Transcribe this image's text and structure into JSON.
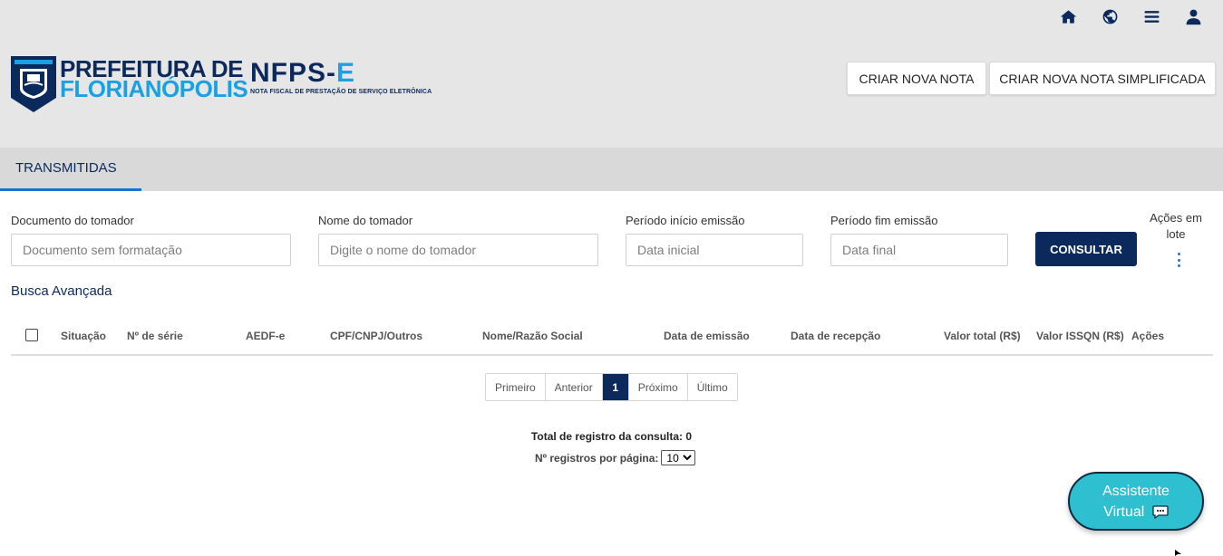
{
  "header": {
    "brand": {
      "line1": "PREFEITURA DE",
      "line2": "FLORIANÓPOLIS"
    },
    "product": {
      "title_main": "NFPS-",
      "title_accent": "E",
      "subtitle": "NOTA FISCAL DE PRESTAÇÃO DE SERVIÇO ELETRÔNICA"
    },
    "icons": [
      "home-icon",
      "globe-icon",
      "menu-icon",
      "user-icon"
    ],
    "buttons": {
      "new_note": "CRIAR NOVA NOTA",
      "new_simple_note": "CRIAR NOVA NOTA SIMPLIFICADA"
    }
  },
  "tabs": [
    {
      "label": "TRANSMITIDAS",
      "active": true
    }
  ],
  "filters": {
    "documento": {
      "label": "Documento do tomador",
      "placeholder": "Documento sem formatação",
      "value": ""
    },
    "nome": {
      "label": "Nome do tomador",
      "placeholder": "Digite o nome do tomador",
      "value": ""
    },
    "inicio": {
      "label": "Período início emissão",
      "placeholder": "Data inicial",
      "value": ""
    },
    "fim": {
      "label": "Período fim emissão",
      "placeholder": "Data final",
      "value": ""
    },
    "consultar": "CONSULTAR",
    "acoes_lote": "Ações em lote",
    "busca_avancada": "Busca Avançada"
  },
  "table": {
    "columns": [
      "Situação",
      "Nº de série",
      "AEDF-e",
      "CPF/CNPJ/Outros",
      "Nome/Razão Social",
      "Data de emissão",
      "Data de recepção",
      "Valor total (R$)",
      "Valor ISSQN (R$)",
      "Ações"
    ],
    "rows": []
  },
  "pagination": {
    "first": "Primeiro",
    "prev": "Anterior",
    "current": "1",
    "next": "Próximo",
    "last": "Último"
  },
  "summary": {
    "total_label": "Total de registro da consulta: 0",
    "per_page_label": "Nº registros por página:",
    "per_page_value": "10"
  },
  "assistant": {
    "line1": "Assistente",
    "line2": "Virtual"
  },
  "colors": {
    "primary": "#0b2a5b",
    "accent": "#1ba1e2",
    "tab_underline": "#1b75d0",
    "assistant_bg": "#2ebfd0"
  }
}
